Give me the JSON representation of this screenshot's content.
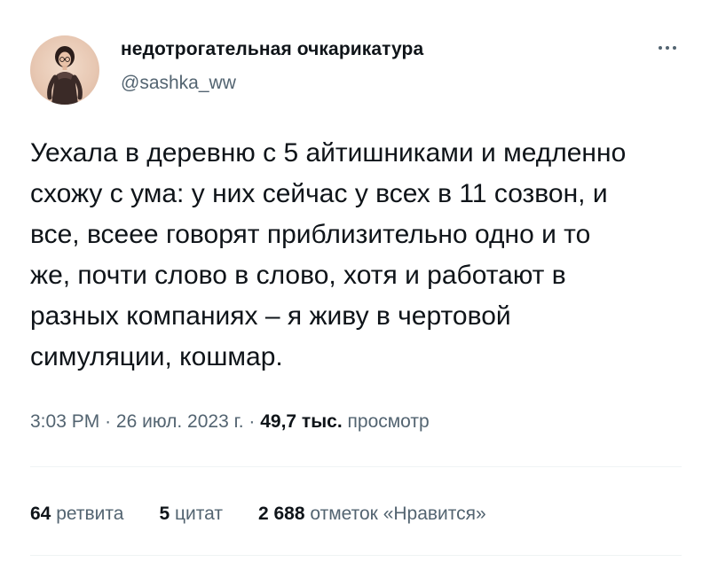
{
  "author": {
    "display_name": "недотрогательная очкарикатура",
    "handle": "@sashka_ww",
    "avatar_icon": "avatar-portrait"
  },
  "more_icon": "ellipsis-icon",
  "tweet": {
    "text": "Уехала в деревню с 5 айтишниками и медленно\nсхожу с ума: у них сейчас у всех в 11 созвон, и\nвсе, всеее говорят приблизительно одно и то\nже, почти слово в слово, хотя и работают в\nразных компаниях – я живу в чертовой\nсимуляции, кошмар."
  },
  "meta": {
    "time": "3:03 PM",
    "separator": "·",
    "date": "26 июл. 2023 г.",
    "views_count": "49,7 тыс.",
    "views_label": "просмотр"
  },
  "stats": {
    "retweets_count": "64",
    "retweets_label": "ретвита",
    "quotes_count": "5",
    "quotes_label": "цитат",
    "likes_count": "2 688",
    "likes_label": "отметок «Нравится»"
  },
  "colors": {
    "text": "#0f1419",
    "secondary": "#536471",
    "divider": "#eff3f4"
  }
}
